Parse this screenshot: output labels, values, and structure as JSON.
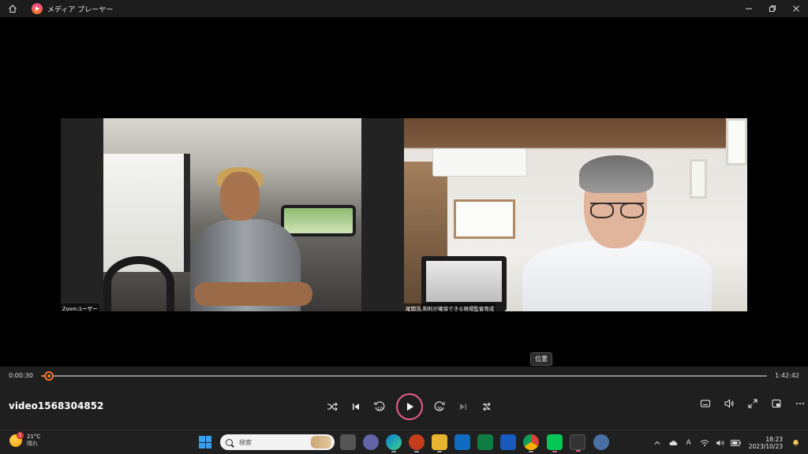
{
  "window": {
    "title": "メディア プレーヤー"
  },
  "video": {
    "left_participant": "Zoomユーザー",
    "right_participant": "尾関浩,和利が確保できる現場監督育成",
    "tooltip": "位置"
  },
  "player": {
    "current_time": "0:00:30",
    "total_time": "1:42:42",
    "progress_fraction": 0.0049,
    "file_name": "video1568304852"
  },
  "taskbar": {
    "weather_temp": "21°C",
    "weather_condition": "晴れ",
    "weather_badge": "1",
    "search_placeholder": "検索",
    "time": "18:23",
    "date": "2023/10/23",
    "ime_label": "A"
  },
  "colors": {
    "accent": "#f07a38",
    "play_ring": "#e85d8c"
  }
}
